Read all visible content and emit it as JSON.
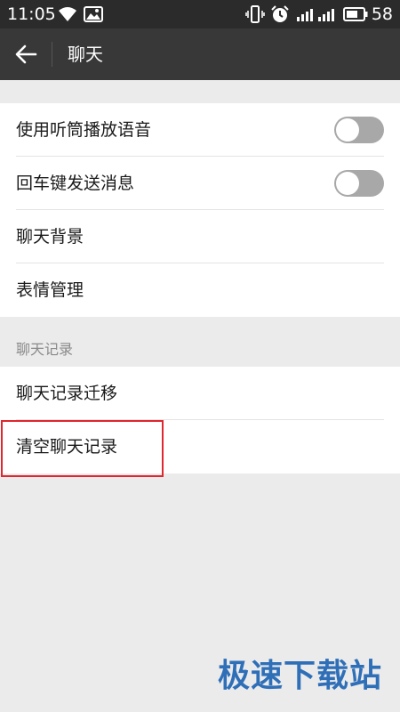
{
  "status_bar": {
    "time": "11:05",
    "battery": "58"
  },
  "app_bar": {
    "title": "聊天"
  },
  "settings": {
    "group1": [
      {
        "label": "使用听筒播放语音",
        "type": "toggle",
        "state": "off"
      },
      {
        "label": "回车键发送消息",
        "type": "toggle",
        "state": "off"
      },
      {
        "label": "聊天背景",
        "type": "link"
      },
      {
        "label": "表情管理",
        "type": "link"
      }
    ],
    "section_header": "聊天记录",
    "group2": [
      {
        "label": "聊天记录迁移",
        "type": "link"
      },
      {
        "label": "清空聊天记录",
        "type": "link",
        "highlighted": true
      }
    ]
  },
  "watermark": "极速下载站",
  "colors": {
    "status_bar_bg": "#2b2b2b",
    "app_bar_bg": "#383838",
    "page_bg": "#ebebeb",
    "toggle_off": "#a8a8a8",
    "highlight_border": "#e0262e",
    "watermark": "#2f6fb8"
  },
  "icons": {
    "back": "arrow-left-icon",
    "wifi": "wifi-icon",
    "image": "image-icon",
    "vibrate": "vibrate-icon",
    "alarm": "alarm-icon",
    "signal": "signal-icon",
    "battery": "battery-icon"
  }
}
